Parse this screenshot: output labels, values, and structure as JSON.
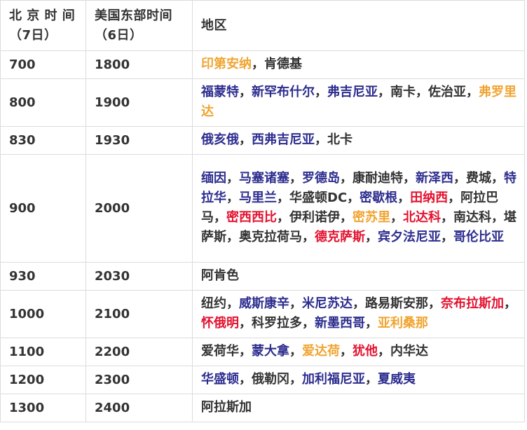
{
  "header": {
    "beijing_line1": "北 京 时 间",
    "beijing_line2": "（7日）",
    "us_line1": "美国东部时间",
    "us_line2": "（6日）",
    "region": "地区"
  },
  "colors": {
    "navy": "#2d2d8f",
    "orange": "#f0a431",
    "red": "#e3122f",
    "dark": "#333333"
  },
  "rows": [
    {
      "bj": "700",
      "us": "1800",
      "height": 40,
      "regions": [
        {
          "t": "印第安纳",
          "c": "orange"
        },
        {
          "t": "，",
          "c": "dark"
        },
        {
          "t": "肯德基",
          "c": "dark"
        }
      ]
    },
    {
      "bj": "800",
      "us": "1900",
      "height": 68,
      "regions": [
        {
          "t": "福蒙特",
          "c": "navy"
        },
        {
          "t": "，",
          "c": "dark"
        },
        {
          "t": "新罕布什尔",
          "c": "navy"
        },
        {
          "t": "，",
          "c": "dark"
        },
        {
          "t": "弗吉尼亚",
          "c": "navy"
        },
        {
          "t": "，",
          "c": "dark"
        },
        {
          "t": "南卡",
          "c": "dark"
        },
        {
          "t": "，",
          "c": "dark"
        },
        {
          "t": "佐治亚",
          "c": "dark"
        },
        {
          "t": "，",
          "c": "dark"
        },
        {
          "t": "弗罗里达",
          "c": "orange"
        }
      ]
    },
    {
      "bj": "830",
      "us": "1930",
      "height": 40,
      "regions": [
        {
          "t": "俄亥俄",
          "c": "navy"
        },
        {
          "t": "，",
          "c": "dark"
        },
        {
          "t": "西弗吉尼亚",
          "c": "navy"
        },
        {
          "t": "，",
          "c": "dark"
        },
        {
          "t": "北卡",
          "c": "dark"
        }
      ]
    },
    {
      "bj": "900",
      "us": "2000",
      "height": 154,
      "regions": [
        {
          "t": "缅因",
          "c": "navy"
        },
        {
          "t": "，",
          "c": "dark"
        },
        {
          "t": "马塞诸塞",
          "c": "navy"
        },
        {
          "t": "，",
          "c": "dark"
        },
        {
          "t": "罗德岛",
          "c": "navy"
        },
        {
          "t": "，",
          "c": "dark"
        },
        {
          "t": "康耐迪特",
          "c": "dark"
        },
        {
          "t": "，",
          "c": "dark"
        },
        {
          "t": "新泽西",
          "c": "navy"
        },
        {
          "t": "，",
          "c": "dark"
        },
        {
          "t": "费城",
          "c": "dark"
        },
        {
          "t": "，",
          "c": "dark"
        },
        {
          "t": "特拉华",
          "c": "navy"
        },
        {
          "t": "，",
          "c": "dark"
        },
        {
          "t": "马里兰",
          "c": "navy"
        },
        {
          "t": "，",
          "c": "dark"
        },
        {
          "t": "华盛顿DC",
          "c": "dark"
        },
        {
          "t": "，",
          "c": "dark"
        },
        {
          "t": "密歇根",
          "c": "navy"
        },
        {
          "t": "，",
          "c": "dark"
        },
        {
          "t": "田纳西",
          "c": "red"
        },
        {
          "t": "，",
          "c": "dark"
        },
        {
          "t": "阿拉巴马",
          "c": "dark"
        },
        {
          "t": "，",
          "c": "dark"
        },
        {
          "t": "密西西比",
          "c": "red"
        },
        {
          "t": "，",
          "c": "dark"
        },
        {
          "t": "伊利诺伊",
          "c": "dark"
        },
        {
          "t": "，",
          "c": "dark"
        },
        {
          "t": "密苏里",
          "c": "orange"
        },
        {
          "t": "，",
          "c": "dark"
        },
        {
          "t": "北达科",
          "c": "red"
        },
        {
          "t": "，",
          "c": "dark"
        },
        {
          "t": "南达科",
          "c": "dark"
        },
        {
          "t": "，",
          "c": "dark"
        },
        {
          "t": "堪萨斯",
          "c": "dark"
        },
        {
          "t": "，",
          "c": "dark"
        },
        {
          "t": "奥克拉荷马",
          "c": "dark"
        },
        {
          "t": "，",
          "c": "dark"
        },
        {
          "t": "德克萨斯",
          "c": "red"
        },
        {
          "t": "，",
          "c": "dark"
        },
        {
          "t": "宾夕法尼亚",
          "c": "navy"
        },
        {
          "t": "，",
          "c": "dark"
        },
        {
          "t": "哥伦比亚",
          "c": "navy"
        }
      ]
    },
    {
      "bj": "930",
      "us": "2030",
      "height": 40,
      "regions": [
        {
          "t": "阿肯色",
          "c": "dark"
        }
      ]
    },
    {
      "bj": "1000",
      "us": "2100",
      "height": 68,
      "regions": [
        {
          "t": "纽约",
          "c": "dark"
        },
        {
          "t": "，",
          "c": "dark"
        },
        {
          "t": "威斯康辛",
          "c": "navy"
        },
        {
          "t": "，",
          "c": "dark"
        },
        {
          "t": "米尼苏达",
          "c": "navy"
        },
        {
          "t": "，",
          "c": "dark"
        },
        {
          "t": "路易斯安那",
          "c": "dark"
        },
        {
          "t": "，",
          "c": "dark"
        },
        {
          "t": "奈布拉斯加",
          "c": "red"
        },
        {
          "t": "，",
          "c": "dark"
        },
        {
          "t": "怀俄明",
          "c": "red"
        },
        {
          "t": "，",
          "c": "dark"
        },
        {
          "t": "科罗拉多",
          "c": "dark"
        },
        {
          "t": "，",
          "c": "dark"
        },
        {
          "t": "新墨西哥",
          "c": "navy"
        },
        {
          "t": "，",
          "c": "dark"
        },
        {
          "t": "亚利桑那",
          "c": "orange"
        }
      ]
    },
    {
      "bj": "1100",
      "us": "2200",
      "height": 40,
      "regions": [
        {
          "t": "爱荷华",
          "c": "dark"
        },
        {
          "t": "，",
          "c": "dark"
        },
        {
          "t": "蒙大拿",
          "c": "navy"
        },
        {
          "t": "，",
          "c": "dark"
        },
        {
          "t": "爱达荷",
          "c": "orange"
        },
        {
          "t": "，",
          "c": "dark"
        },
        {
          "t": "犹他",
          "c": "red"
        },
        {
          "t": "，",
          "c": "dark"
        },
        {
          "t": "内华达",
          "c": "dark"
        }
      ]
    },
    {
      "bj": "1200",
      "us": "2300",
      "height": 40,
      "regions": [
        {
          "t": "华盛顿",
          "c": "navy"
        },
        {
          "t": "，",
          "c": "dark"
        },
        {
          "t": "俄勒冈",
          "c": "dark"
        },
        {
          "t": "，",
          "c": "dark"
        },
        {
          "t": "加利福尼亚",
          "c": "navy"
        },
        {
          "t": "，",
          "c": "dark"
        },
        {
          "t": "夏威夷",
          "c": "navy"
        }
      ]
    },
    {
      "bj": "1300",
      "us": "2400",
      "height": 40,
      "regions": [
        {
          "t": "阿拉斯加",
          "c": "dark"
        }
      ]
    }
  ]
}
